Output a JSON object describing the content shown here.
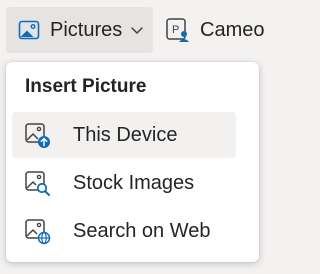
{
  "toolbar": {
    "pictures_label": "Pictures",
    "cameo_label": "Cameo",
    "cameo_icon_letter": "P"
  },
  "menu": {
    "header": "Insert Picture",
    "items": [
      {
        "label": "This Device",
        "icon": "image-upload-icon"
      },
      {
        "label": "Stock Images",
        "icon": "image-search-icon"
      },
      {
        "label": "Search on Web",
        "icon": "image-globe-icon"
      }
    ]
  },
  "colors": {
    "accent": "#0f6cbd",
    "icon_stroke": "#424242"
  }
}
